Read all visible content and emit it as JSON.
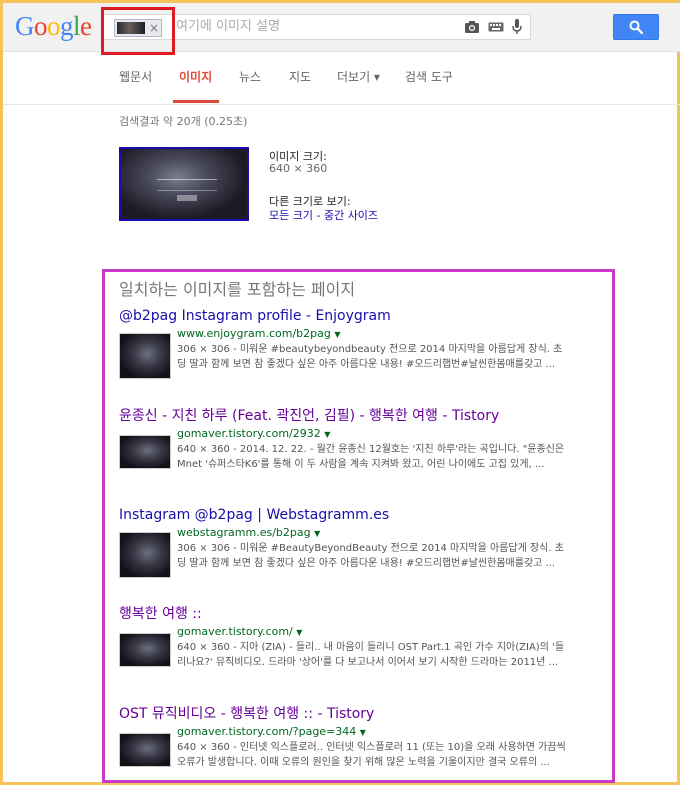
{
  "header": {
    "logo_letters": [
      {
        "ch": "G",
        "color": "#4285f4"
      },
      {
        "ch": "o",
        "color": "#ea4335"
      },
      {
        "ch": "o",
        "color": "#fbbc05"
      },
      {
        "ch": "g",
        "color": "#4285f4"
      },
      {
        "ch": "l",
        "color": "#34a853"
      },
      {
        "ch": "e",
        "color": "#ea4335"
      }
    ],
    "search_placeholder": "여기에 이미지 설명",
    "chip_close": "×"
  },
  "tabs": [
    "웹문서",
    "이미지",
    "뉴스",
    "지도",
    "더보기 ▾",
    "검색 도구"
  ],
  "active_tab": "이미지",
  "result_stats": "검색결과 약 20개 (0.25초)",
  "image_info": {
    "size_label": "이미지 크기:",
    "size_value": "640 × 360",
    "other_sizes_label": "다른 크기로 보기:",
    "all_sizes": "모든 크기",
    "separator": " - ",
    "medium_sizes": "중간 사이즈"
  },
  "section_heading": "일치하는 이미지를 포함하는 페이지",
  "results": [
    {
      "title": "@b2pag Instagram profile - Enjoygram",
      "url": "www.enjoygram.com/b2pag",
      "snippet": "306 × 306 - 미워운 #beautybeyondbeauty 전으로 2014 마지막을 아름답게 장식. 초딩 딸과 함께 보면 참 좋겠다 싶은 아주 아름다운 내용! #오드리햅번#날씬한몸매를갖고 ..."
    },
    {
      "title": "윤종신 - 지친 하루 (Feat. 곽진언, 김필) - 행복한 여행 - Tistory",
      "url": "gomaver.tistory.com/2932",
      "snippet": "640 × 360 - 2014. 12. 22. - 월간 윤종신 12월호는 '지친 하루'라는 곡입니다. \"윤종신은 Mnet '슈퍼스타K6'를 통해 이 두 사람을 계속 지켜봐 왔고, 어린 나이에도 고집 있게, ..."
    },
    {
      "title": "Instagram @b2pag | Webstagramm.es",
      "url": "webstagramm.es/b2pag",
      "snippet": "306 × 306 - 미워운 #BeautyBeyondBeauty 전으로 2014 마지막을 아름답게 장식. 초딩 딸과 함께 보면 참 좋겠다 싶은 아주 아름다운 내용! #오드리햅번#날씬한몸매를갖고 ..."
    },
    {
      "title": "행복한 여행 ::",
      "url": "gomaver.tistory.com/",
      "snippet": "640 × 360 - 지아 (ZIA) - 들리.. 내 마음이 들리니 OST Part.1 곡인 가수 지아(ZIA)의 '들리나요?' 뮤직비디오. 드라마 '상어'를 다 보고나서 이어서 보기 시작한 드라마는 2011년 ..."
    },
    {
      "title": "OST 뮤직비디오 - 행복한 여행 :: - Tistory",
      "url": "gomaver.tistory.com/?page=344",
      "snippet": "640 × 360 - 인터넷 익스플로러.. 인터넷 익스플로러 11 (또는 10)을 오래 사용하면 가끔씩 오류가 발생합니다. 이때 오류의 원인을 찾기 위해 많은 노력을 기울이지만 결국 오류의 ..."
    }
  ],
  "colors": {
    "link": "#1a0dab",
    "visited": "#660099",
    "url_green": "#006621",
    "active_tab": "#dd4b39",
    "annotation_red": "#e01b24",
    "annotation_magenta": "#c939c8",
    "frame_yellow": "#f5c35b"
  }
}
